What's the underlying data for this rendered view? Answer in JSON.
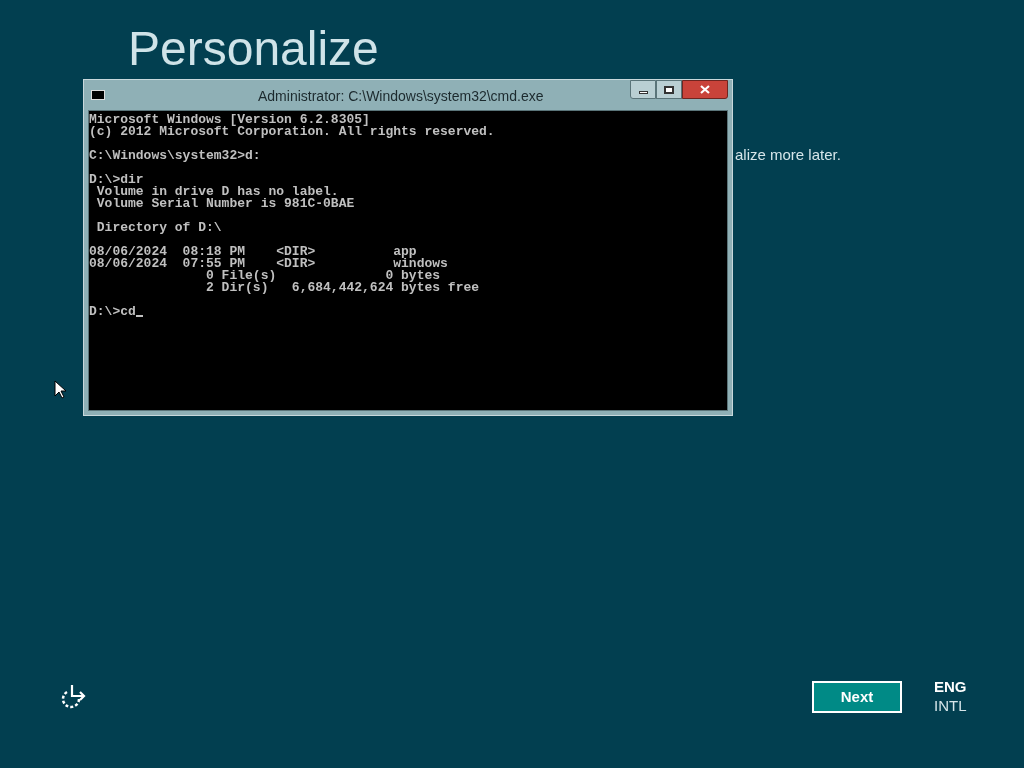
{
  "page": {
    "heading": "Personalize",
    "hint_fragment": "alize more later."
  },
  "console_window": {
    "title": "Administrator: C:\\Windows\\system32\\cmd.exe",
    "blocks": [
      [
        "Microsoft Windows [Version 6.2.8305]",
        "(c) 2012 Microsoft Corporation. All rights reserved."
      ],
      [
        "C:\\Windows\\system32>d:"
      ],
      [
        "D:\\>dir",
        " Volume in drive D has no label.",
        " Volume Serial Number is 981C-0BAE"
      ],
      [
        " Directory of D:\\"
      ],
      [
        "08/06/2024  08:18 PM    <DIR>          app",
        "08/06/2024  07:55 PM    <DIR>          windows",
        "               0 File(s)              0 bytes",
        "               2 Dir(s)   6,684,442,624 bytes free"
      ],
      [
        "D:\\>cd"
      ]
    ]
  },
  "footer": {
    "next_button": "Next",
    "language": "ENG",
    "layout": "INTL"
  }
}
